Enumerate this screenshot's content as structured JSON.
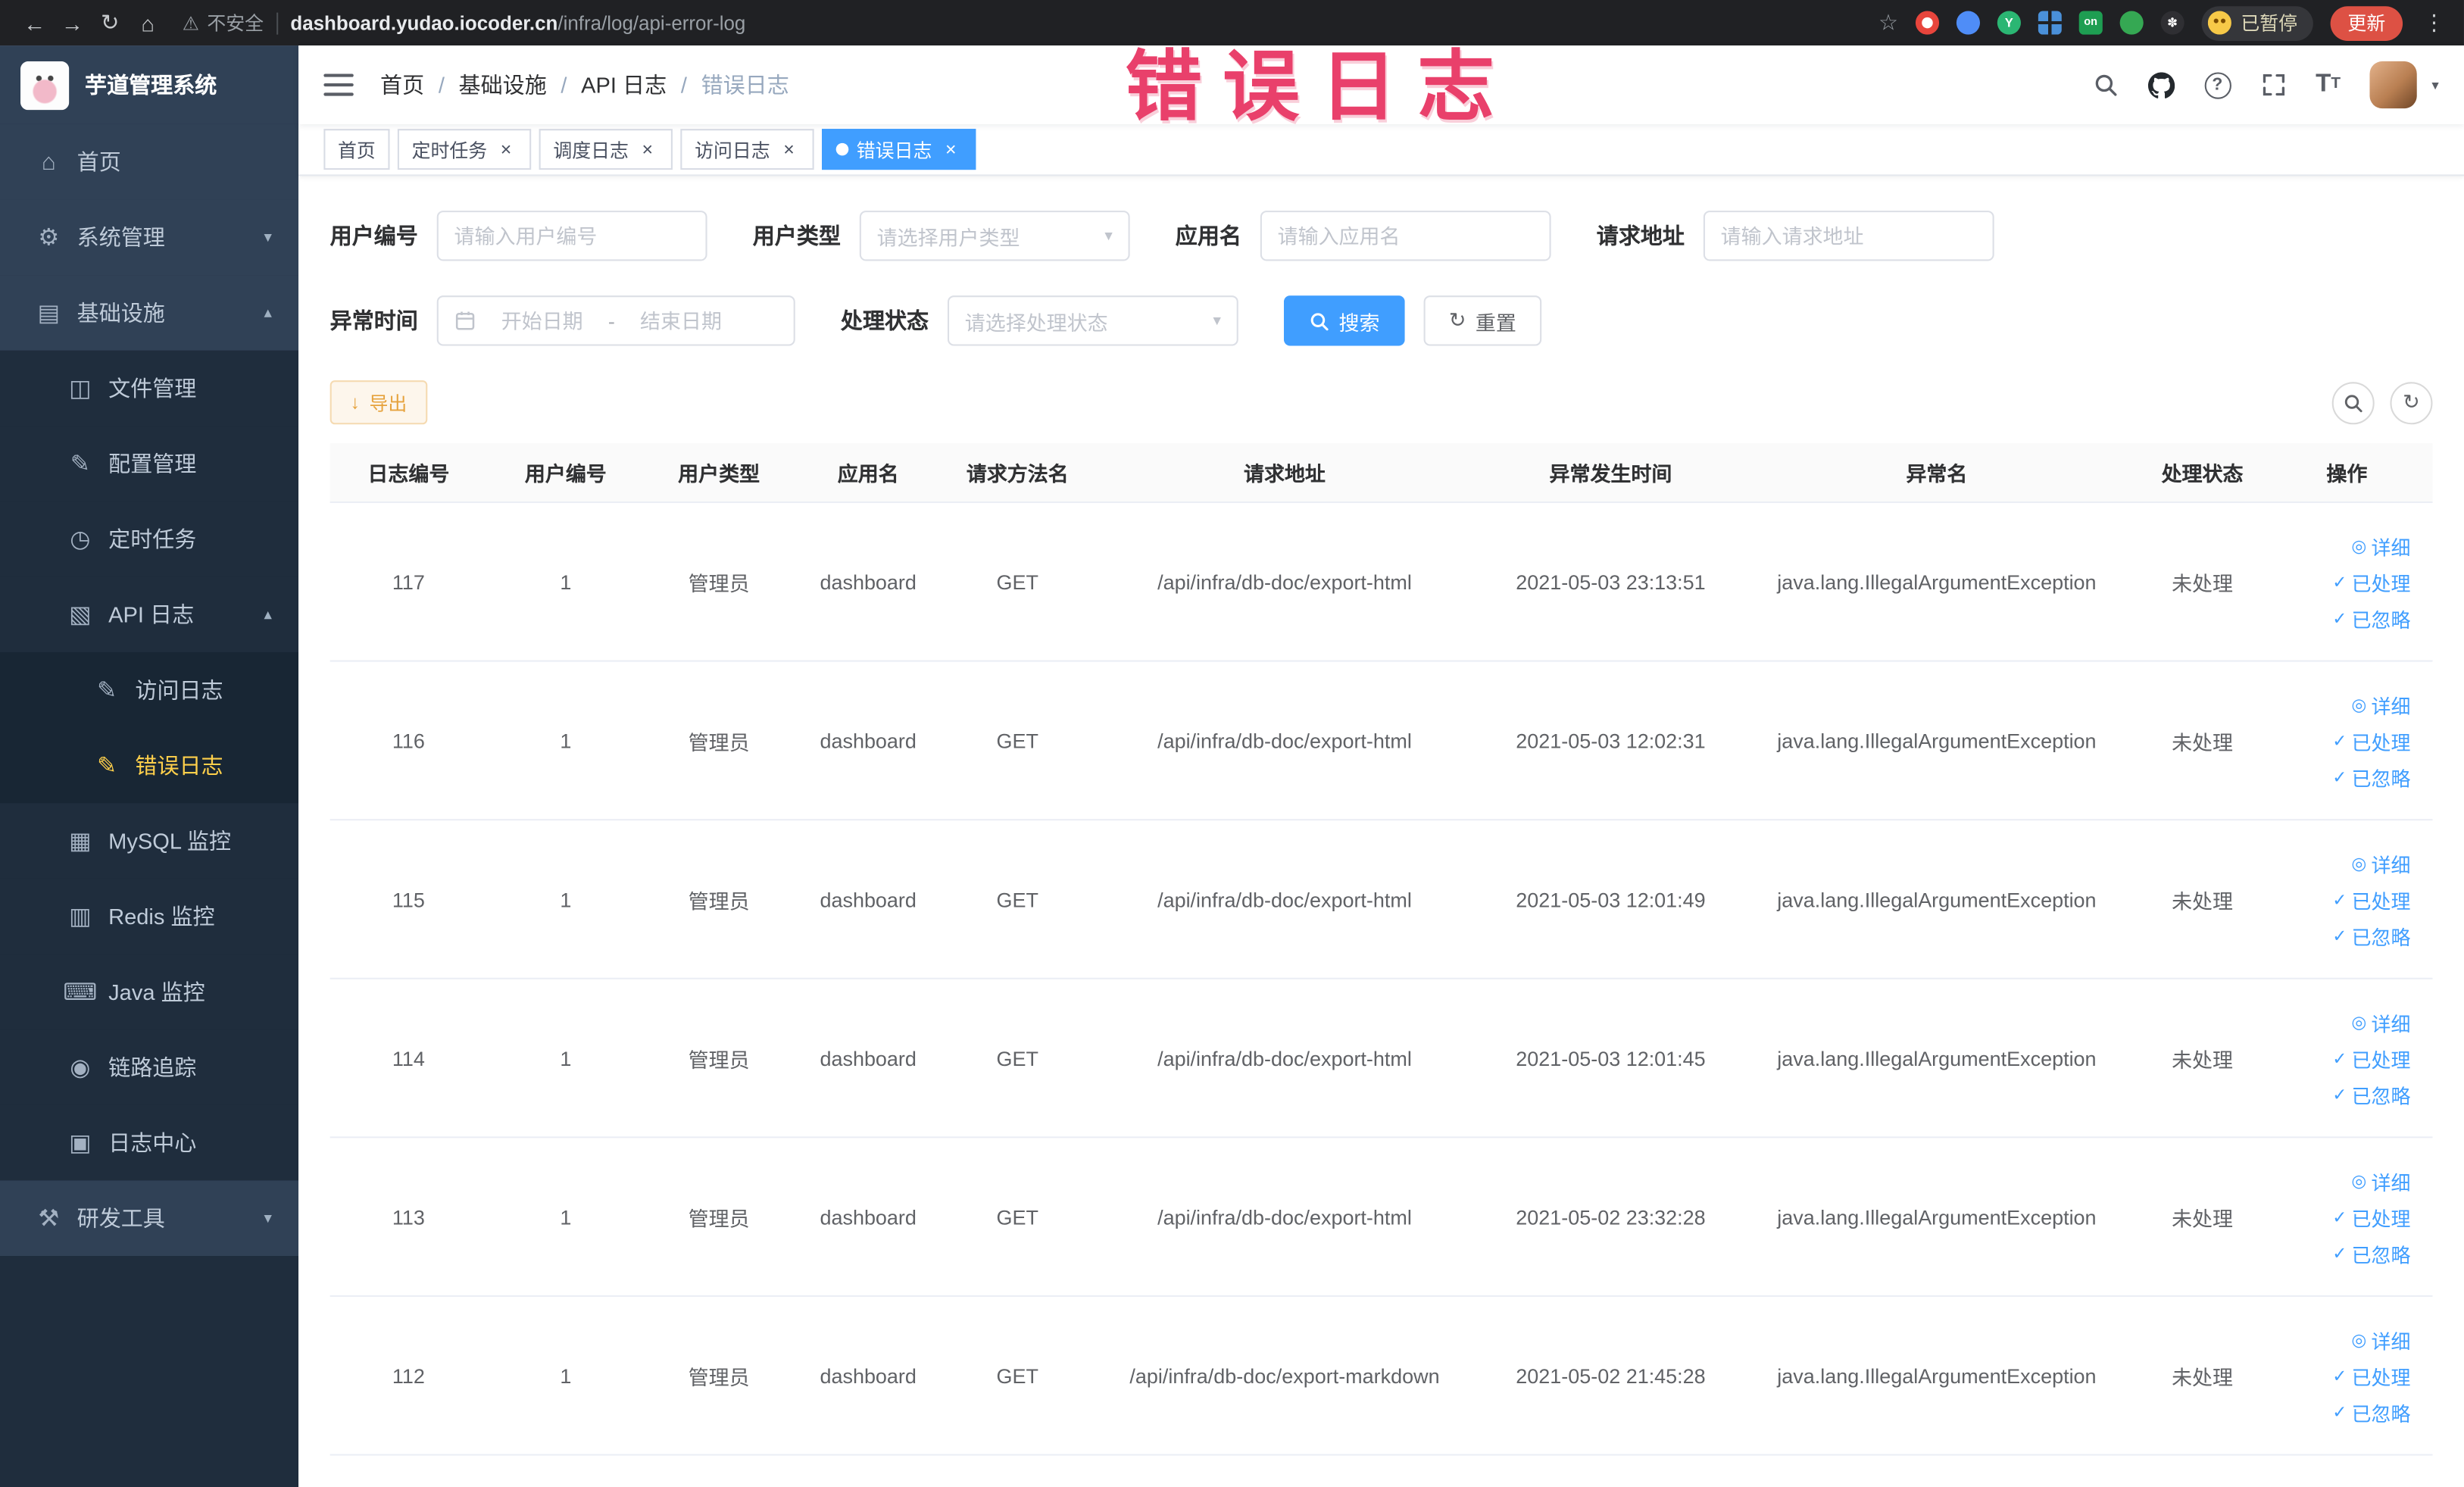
{
  "browser": {
    "back_icon": "←",
    "forward_icon": "→",
    "reload_icon": "↻",
    "home_icon": "⌂",
    "warning_icon": "⚠",
    "security_warning": "不安全",
    "url_host": "dashboard.yudao.iocoder.cn",
    "url_path": "/infra/log/api-error-log",
    "star_icon": "☆",
    "ext_y_letter": "Y",
    "ext_on_badge": "on",
    "ext_paw_glyph": "✽",
    "paused_badge": "已暂停",
    "update_button": "更新",
    "kebab_icon": "⋮"
  },
  "annotation": "错误日志",
  "sidebar": {
    "logo_title": "芋道管理系统",
    "menu": [
      {
        "label": "首页",
        "glyph": "⌂"
      },
      {
        "label": "系统管理",
        "glyph": "⚙",
        "chevron": "▾"
      },
      {
        "label": "基础设施",
        "glyph": "▤",
        "chevron": "▴"
      },
      {
        "label": "文件管理",
        "glyph": "◫"
      },
      {
        "label": "配置管理",
        "glyph": "✎"
      },
      {
        "label": "定时任务",
        "glyph": "◷"
      },
      {
        "label": "API 日志",
        "glyph": "▧",
        "chevron": "▴"
      },
      {
        "label": "访问日志",
        "glyph": "✎"
      },
      {
        "label": "错误日志",
        "glyph": "✎"
      },
      {
        "label": "MySQL 监控",
        "glyph": "▦"
      },
      {
        "label": "Redis 监控",
        "glyph": "▥"
      },
      {
        "label": "Java 监控",
        "glyph": "⌨"
      },
      {
        "label": "链路追踪",
        "glyph": "◉"
      },
      {
        "label": "日志中心",
        "glyph": "▣"
      },
      {
        "label": "研发工具",
        "glyph": "⚒",
        "chevron": "▾"
      }
    ]
  },
  "navbar": {
    "breadcrumb": [
      "首页",
      "基础设施",
      "API 日志",
      "错误日志"
    ],
    "separator": "/",
    "help_glyph": "?",
    "font_size_glyph": "T",
    "caret_icon": "▾"
  },
  "tabs": [
    {
      "label": "首页",
      "closable": false,
      "active": false
    },
    {
      "label": "定时任务",
      "closable": true,
      "active": false
    },
    {
      "label": "调度日志",
      "closable": true,
      "active": false
    },
    {
      "label": "访问日志",
      "closable": true,
      "active": false
    },
    {
      "label": "错误日志",
      "closable": true,
      "active": true
    }
  ],
  "tab_close_icon": "×",
  "filters": {
    "user_id_label": "用户编号",
    "user_id_placeholder": "请输入用户编号",
    "user_type_label": "用户类型",
    "user_type_placeholder": "请选择用户类型",
    "app_name_label": "应用名",
    "app_name_placeholder": "请输入应用名",
    "request_url_label": "请求地址",
    "request_url_placeholder": "请输入请求地址",
    "exception_time_label": "异常时间",
    "date_start_placeholder": "开始日期",
    "date_separator": "-",
    "date_end_placeholder": "结束日期",
    "process_status_label": "处理状态",
    "process_status_placeholder": "请选择处理状态",
    "search_button": "搜索",
    "reset_button": "重置",
    "reset_icon": "↻",
    "select_caret": "▾"
  },
  "toolbar": {
    "export_button": "导出",
    "export_icon": "↓",
    "refresh_icon": "↻"
  },
  "table": {
    "columns": [
      "日志编号",
      "用户编号",
      "用户类型",
      "应用名",
      "请求方法名",
      "请求地址",
      "异常发生时间",
      "异常名",
      "处理状态",
      "操作"
    ],
    "rows": [
      {
        "log_id": "117",
        "user_id": "1",
        "user_type": "管理员",
        "app_name": "dashboard",
        "method": "GET",
        "url": "/api/infra/db-doc/export-html",
        "time": "2021-05-03 23:13:51",
        "exception": "java.lang.IllegalArgumentException",
        "status": "未处理"
      },
      {
        "log_id": "116",
        "user_id": "1",
        "user_type": "管理员",
        "app_name": "dashboard",
        "method": "GET",
        "url": "/api/infra/db-doc/export-html",
        "time": "2021-05-03 12:02:31",
        "exception": "java.lang.IllegalArgumentException",
        "status": "未处理"
      },
      {
        "log_id": "115",
        "user_id": "1",
        "user_type": "管理员",
        "app_name": "dashboard",
        "method": "GET",
        "url": "/api/infra/db-doc/export-html",
        "time": "2021-05-03 12:01:49",
        "exception": "java.lang.IllegalArgumentException",
        "status": "未处理"
      },
      {
        "log_id": "114",
        "user_id": "1",
        "user_type": "管理员",
        "app_name": "dashboard",
        "method": "GET",
        "url": "/api/infra/db-doc/export-html",
        "time": "2021-05-03 12:01:45",
        "exception": "java.lang.IllegalArgumentException",
        "status": "未处理"
      },
      {
        "log_id": "113",
        "user_id": "1",
        "user_type": "管理员",
        "app_name": "dashboard",
        "method": "GET",
        "url": "/api/infra/db-doc/export-html",
        "time": "2021-05-02 23:32:28",
        "exception": "java.lang.IllegalArgumentException",
        "status": "未处理"
      },
      {
        "log_id": "112",
        "user_id": "1",
        "user_type": "管理员",
        "app_name": "dashboard",
        "method": "GET",
        "url": "/api/infra/db-doc/export-markdown",
        "time": "2021-05-02 21:45:28",
        "exception": "java.lang.IllegalArgumentException",
        "status": "未处理"
      }
    ],
    "row_actions": {
      "detail_icon": "◎",
      "detail_label": "详细",
      "processed_icon": "✓",
      "processed_label": "已处理",
      "ignored_icon": "✓",
      "ignored_label": "已忽略"
    }
  }
}
